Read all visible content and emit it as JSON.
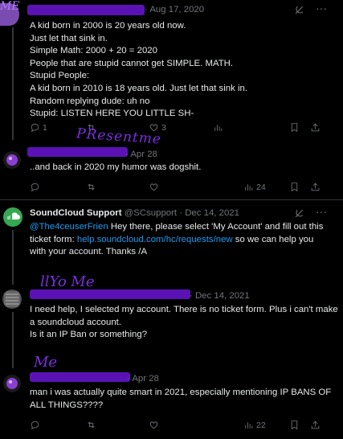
{
  "posts": [
    {
      "id": "p1",
      "date": "· Aug 17, 2020",
      "lines": [
        "A kid born in 2000 is 20 years old now.",
        "Just let that sink in.",
        "Simple Math: 2000 + 20 = 2020",
        "People that are stupid cannot get SIMPLE. MATH.",
        "Stupid People:",
        "A kid born in 2010 is 18 years old. Just let that sink in.",
        "Random replying dude: uh no",
        "Stupid: LISTEN HERE YOU LITTLE SH-"
      ],
      "stats": {
        "replies": "1",
        "likes": "3"
      }
    },
    {
      "id": "p2",
      "date": "· Apr 28",
      "handwritten_label": "PResentme",
      "lines": [
        "..and back in 2020 my humor was dogshit."
      ],
      "stats": {
        "views": "24"
      }
    },
    {
      "id": "p3",
      "name": "SoundCloud Support",
      "handle": "@SCsupport",
      "date": "· Dec 14, 2021",
      "mention": "@The4ceuserFrien",
      "line1_rest": " Hey there, please select 'My Account' and fill out this",
      "line2_pre": "ticket form: ",
      "link": "help.soundcloud.com/hc/requests/new",
      "line2_post": " so we can help you",
      "line3": "with your account. Thanks /A"
    },
    {
      "id": "p4",
      "date": "· Dec 14, 2021",
      "handwritten_label": "llYo Me",
      "lines": [
        "I need help, I selected my account. There is no ticket form. Plus i can't make",
        "a soundcloud account.",
        "Is it an IP Ban or something?"
      ]
    },
    {
      "id": "p5",
      "date": "· Apr 28",
      "handwritten_label": "Me",
      "lines": [
        "man i was actually quite smart in 2021, especially mentioning IP BANS OF",
        "ALL THINGS????"
      ],
      "stats": {
        "views": "22"
      }
    }
  ],
  "colors": {
    "background": "#000000",
    "text": "#e7e9ea",
    "muted": "#71767b",
    "link": "#1d9bf0",
    "redaction": "#5b12b5",
    "soundcloud": "#ff5500"
  },
  "icons": [
    "reply-icon",
    "retweet-icon",
    "like-icon",
    "views-icon",
    "bookmark-icon",
    "share-icon",
    "grok-icon",
    "more-icon"
  ]
}
